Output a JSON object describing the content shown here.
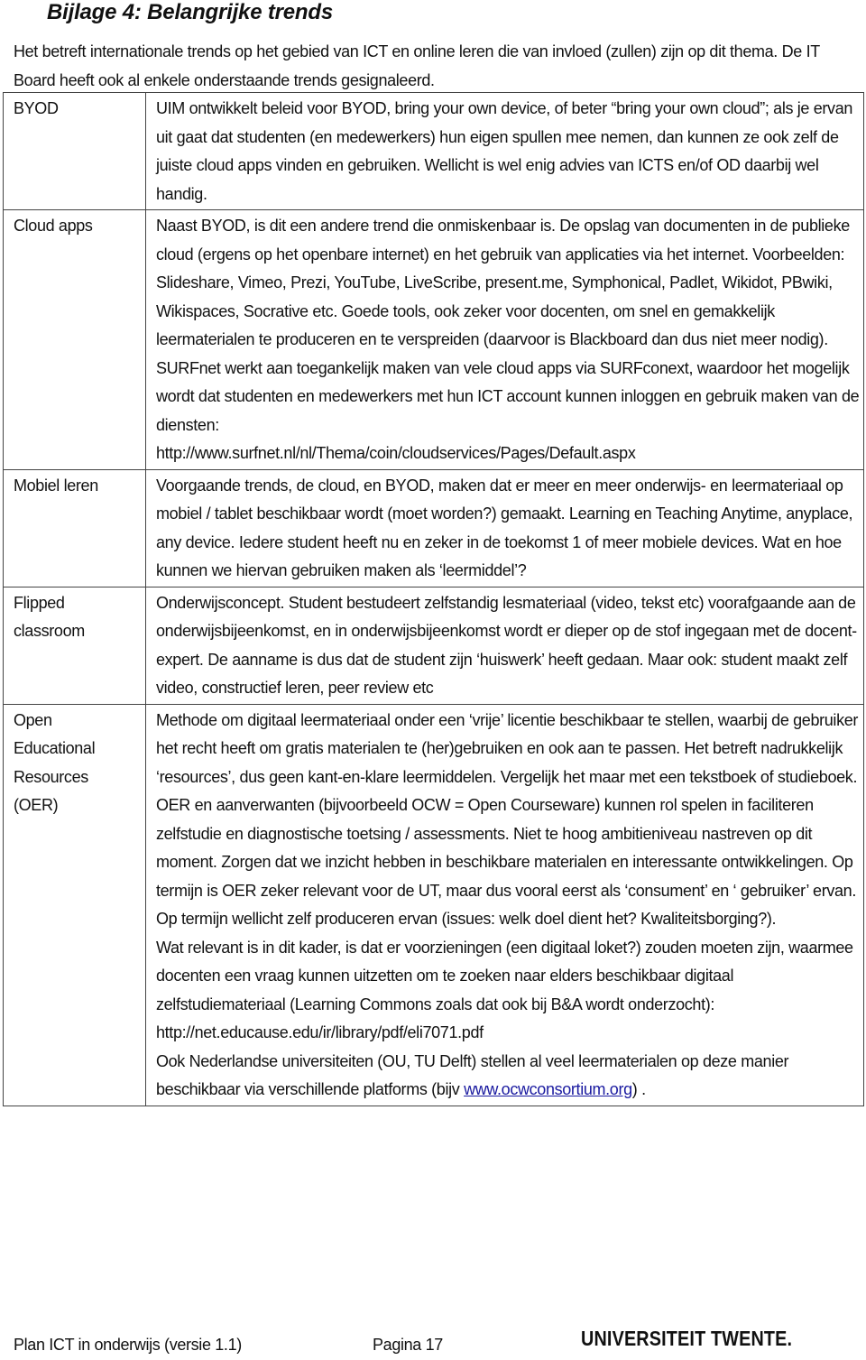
{
  "document": {
    "title": "Bijlage 4: Belangrijke trends",
    "intro": "Het betreft internationale trends op het gebied van ICT en online leren die van invloed (zullen) zijn op dit thema. De IT Board heeft ook al enkele onderstaande trends gesignaleerd.",
    "trends": [
      {
        "term": "BYOD",
        "paragraphs": [
          "UIM ontwikkelt beleid voor BYOD, bring your own device, of beter “bring your own cloud”; als je ervan uit gaat dat studenten (en medewerkers) hun eigen spullen mee nemen, dan kunnen ze ook zelf de juiste cloud apps vinden en gebruiken. Wellicht is wel enig advies van ICTS en/of OD daarbij wel handig."
        ]
      },
      {
        "term": "Cloud apps",
        "paragraphs": [
          "Naast BYOD, is dit een andere trend die onmiskenbaar is. De opslag van documenten in de publieke cloud (ergens op het openbare internet) en het gebruik van applicaties via het internet. Voorbeelden: Slideshare, Vimeo, Prezi, YouTube, LiveScribe, present.me, Symphonical, Padlet, Wikidot, PBwiki, Wikispaces, Socrative etc. Goede tools, ook zeker voor docenten, om snel en gemakkelijk leermaterialen te produceren en te verspreiden (daarvoor is Blackboard dan dus niet meer nodig). SURFnet werkt aan toegankelijk maken van vele cloud apps via SURFconext, waardoor het mogelijk wordt dat studenten en medewerkers met hun ICT account kunnen inloggen en gebruik maken van de diensten:",
          "http://www.surfnet.nl/nl/Thema/coin/cloudservices/Pages/Default.aspx"
        ]
      },
      {
        "term": "Mobiel leren",
        "paragraphs": [
          "Voorgaande trends, de cloud, en BYOD, maken dat er meer en meer onderwijs- en leermateriaal op mobiel / tablet beschikbaar wordt (moet worden?) gemaakt. Learning en Teaching Anytime, anyplace, any device. Iedere student heeft nu en zeker in de toekomst 1 of meer mobiele devices. Wat en hoe kunnen we hiervan gebruiken maken als ‘leermiddel’?"
        ]
      },
      {
        "term_lines": [
          "Flipped",
          "classroom"
        ],
        "term": "Flipped classroom",
        "paragraphs": [
          "Onderwijsconcept. Student bestudeert zelfstandig lesmateriaal (video, tekst etc) voorafgaande aan de onderwijsbijeenkomst, en in onderwijsbijeenkomst wordt er dieper op de stof ingegaan met de docent-expert. De aanname is dus dat de student zijn ‘huiswerk’ heeft gedaan. Maar ook: student maakt zelf video, constructief leren, peer review etc"
        ]
      },
      {
        "term_lines": [
          "Open",
          "Educational",
          "Resources",
          "(OER)"
        ],
        "term": "Open Educational Resources (OER)",
        "paragraphs": [
          "Methode om digitaal leermateriaal onder een ‘vrije’ licentie beschikbaar te stellen, waarbij de gebruiker het recht heeft om gratis materialen te (her)gebruiken en ook aan te passen. Het betreft nadrukkelijk ‘resources’, dus geen kant-en-klare leermiddelen. Vergelijk het maar met een tekstboek of studieboek.",
          "OER en aanverwanten (bijvoorbeeld OCW = Open Courseware) kunnen rol spelen in faciliteren zelfstudie en diagnostische toetsing / assessments. Niet te hoog ambitieniveau nastreven op dit moment. Zorgen dat we inzicht hebben in beschikbare materialen en interessante ontwikkelingen. Op termijn is OER zeker relevant voor de UT, maar dus vooral eerst als ‘consument’ en ‘ gebruiker’ ervan. Op termijn wellicht zelf produceren ervan (issues: welk doel dient het? Kwaliteitsborging?).",
          "Wat relevant is in dit kader, is dat er voorzieningen (een digitaal loket?) zouden moeten zijn, waarmee docenten een vraag kunnen uitzetten om te zoeken naar elders beschikbaar digitaal zelfstudiemateriaal (Learning Commons zoals dat ook bij B&A wordt onderzocht):  http://net.educause.edu/ir/library/pdf/eli7071.pdf"
        ],
        "final_paragraph": {
          "before_link": "Ook Nederlandse universiteiten (OU, TU Delft) stellen al veel leermaterialen op deze manier beschikbaar via verschillende platforms (bijv ",
          "link_text": "www.ocwconsortium.org",
          "after_link": ") ."
        }
      }
    ]
  },
  "footer": {
    "left": "Plan ICT in onderwijs (versie 1.1)",
    "page": "Pagina 17",
    "logo": "UNIVERSITEIT TWENTE."
  },
  "colors": {
    "text": "#111111",
    "link": "#1a1aa0",
    "border": "#444444"
  }
}
